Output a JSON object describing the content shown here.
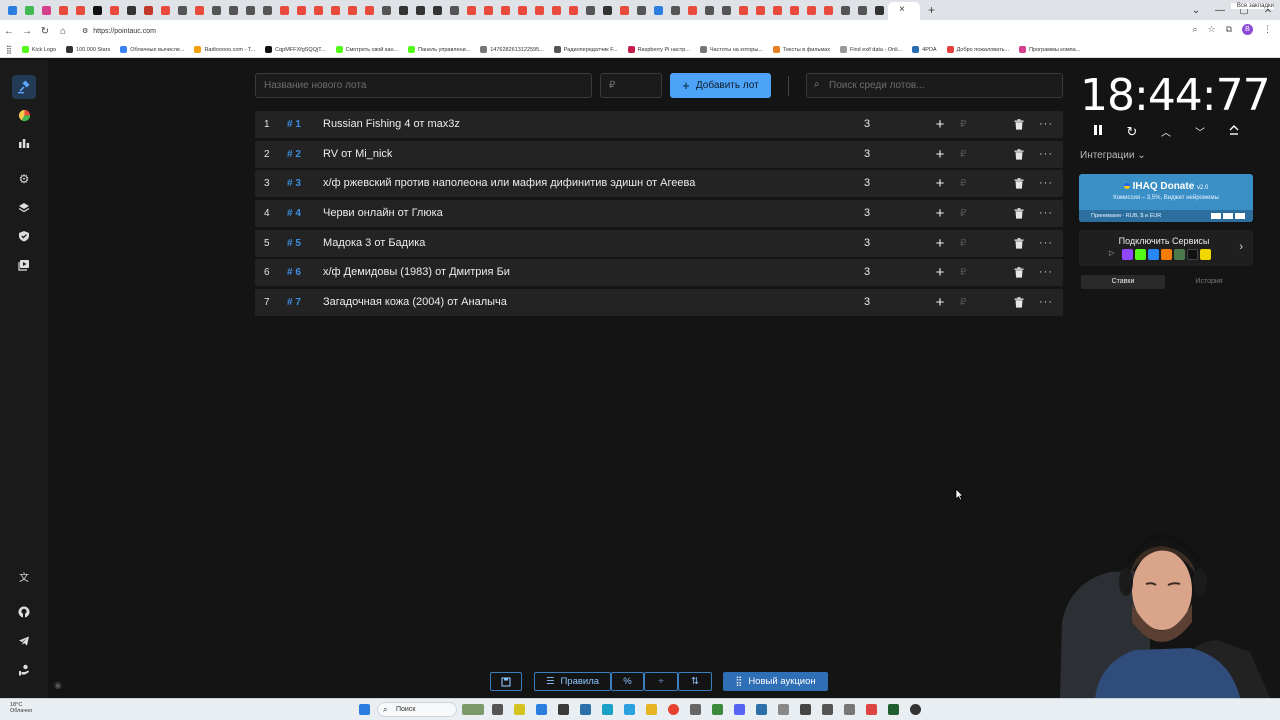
{
  "browser": {
    "url": "https://pointauc.com",
    "new_tab": "+",
    "close_tab": "×",
    "window_controls": [
      "⌄",
      "—",
      "▢",
      "✕"
    ],
    "bookmarks": [
      {
        "label": "Kick Logo",
        "color": "#53fc18"
      },
      {
        "label": "100.000 Stars",
        "color": "#333333"
      },
      {
        "label": "Облачные вычисле...",
        "color": "#3b82f6"
      },
      {
        "label": "Radiooooo.com - T...",
        "color": "#f59e0b"
      },
      {
        "label": "CqpMFFXfgSQQjT...",
        "color": "#111111"
      },
      {
        "label": "Смотреть свой кан...",
        "color": "#53fc18"
      },
      {
        "label": "Панель управлени...",
        "color": "#53fc18"
      },
      {
        "label": "1476282613122595...",
        "color": "#777777"
      },
      {
        "label": "Радиопередатчик F...",
        "color": "#555555"
      },
      {
        "label": "Raspberry Pi настр...",
        "color": "#c51a4a"
      },
      {
        "label": "Частоты на которы...",
        "color": "#777777"
      },
      {
        "label": "Тексты в фильмах",
        "color": "#e67e22"
      },
      {
        "label": "Find exif data - Onli...",
        "color": "#999999"
      },
      {
        "label": "4PDA",
        "color": "#2b6cb0"
      },
      {
        "label": "Добро пожаловать...",
        "color": "#e53e3e"
      },
      {
        "label": "Программы компа...",
        "color": "#d53f8c"
      }
    ],
    "bookmarks_all": "Все закладки"
  },
  "toolbar": {
    "lot_name_placeholder": "Название нового лота",
    "amount_placeholder": "₽",
    "add_button_label": "Добавить лот",
    "search_placeholder": "Поиск среди лотов..."
  },
  "lots": [
    {
      "index": "1",
      "id": "# 1",
      "title": "Russian Fishing 4 от max3z",
      "amount": "3"
    },
    {
      "index": "2",
      "id": "# 2",
      "title": "RV от Mi_nick",
      "amount": "3"
    },
    {
      "index": "3",
      "id": "# 3",
      "title": "х/ф ржевский против наполеона или мафия дифинитив эдишн от Агеева",
      "amount": "3"
    },
    {
      "index": "4",
      "id": "# 4",
      "title": "Черви онлайн от Глюка",
      "amount": "3"
    },
    {
      "index": "5",
      "id": "# 5",
      "title": "Мадока 3 от Бадика",
      "amount": "3"
    },
    {
      "index": "6",
      "id": "# 6",
      "title": "х/ф Демидовы (1983) от Дмитрия Би",
      "amount": "3"
    },
    {
      "index": "7",
      "id": "# 7",
      "title": "Загадочная кожа (2004) от Аналыча",
      "amount": "3"
    }
  ],
  "lot_row": {
    "plus": "+",
    "rub": "₽",
    "more": "···"
  },
  "timer": {
    "display": "18:44:77"
  },
  "integrations": {
    "label": "Интеграции ⌄"
  },
  "donate": {
    "title": "IHAQ Donate",
    "version": "v2.0",
    "commission": "Комиссия – 3,5%, Виджет нейромемы",
    "accepts": "Принимаем - RUB, $ и EUR"
  },
  "services": {
    "title": "Подключить Сервисы"
  },
  "tabs": {
    "bids": "Ставки",
    "history": "История"
  },
  "bottom": {
    "rules_label": "Правила",
    "new_auction_label": "Новый аукцион"
  },
  "taskbar": {
    "weather_temp": "18°C",
    "weather_desc": "Облачно",
    "search_label": "Поиск"
  },
  "colors": {
    "accent": "#4da3f7",
    "lot_id": "#3d8ee0",
    "row_bg": "#232323",
    "page_bg": "#141414"
  }
}
